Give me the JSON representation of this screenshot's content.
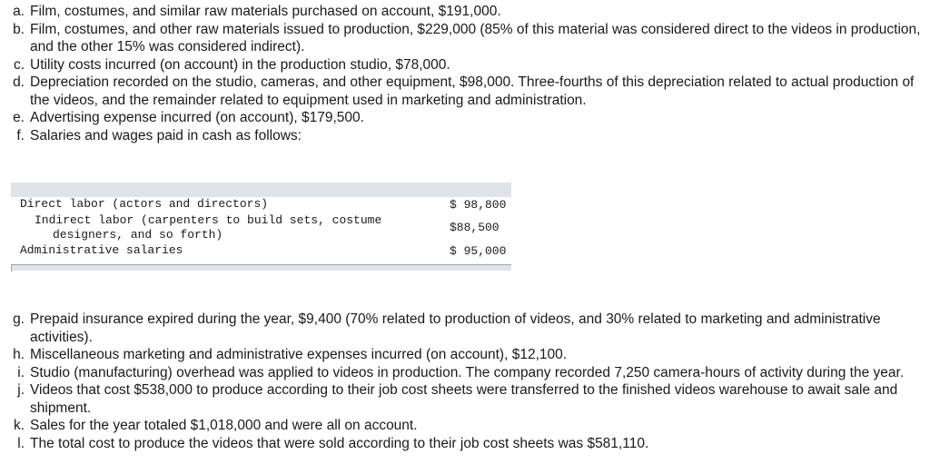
{
  "items_top": [
    {
      "marker": "a.",
      "text": "Film, costumes, and similar raw materials purchased on account, $191,000."
    },
    {
      "marker": "b.",
      "text": "Film, costumes, and other raw materials issued to production, $229,000 (85% of this material was considered direct to the videos in production, and the other 15% was considered indirect)."
    },
    {
      "marker": "c.",
      "text": "Utility costs incurred (on account) in the production studio, $78,000."
    },
    {
      "marker": "d.",
      "text": "Depreciation recorded on the studio, cameras, and other equipment, $98,000. Three-fourths of this depreciation related to actual production of the videos, and the remainder related to equipment used in marketing and administration."
    },
    {
      "marker": "e.",
      "text": "Advertising expense incurred (on account), $179,500."
    },
    {
      "marker": "f.",
      "text": "Salaries and wages paid in cash as follows:"
    }
  ],
  "salaries_table": {
    "rows": [
      {
        "line1": "Direct labor (actors and directors)",
        "line2": "",
        "amount": "$ 98,800"
      },
      {
        "line1": "Indirect labor (carpenters to build sets, costume",
        "line2": "designers, and so forth)",
        "amount": "$88,500"
      },
      {
        "line1": "Administrative salaries",
        "line2": "",
        "amount": "$ 95,000"
      }
    ]
  },
  "items_bottom": [
    {
      "marker": "g.",
      "text": "Prepaid insurance expired during the year, $9,400 (70% related to production of videos, and 30% related to marketing and administrative activities)."
    },
    {
      "marker": "h.",
      "text": "Miscellaneous marketing and administrative expenses incurred (on account), $12,100."
    },
    {
      "marker": "i.",
      "text": "Studio (manufacturing) overhead was applied to videos in production. The company recorded 7,250 camera-hours of activity during the year."
    },
    {
      "marker": "j.",
      "text": "Videos that cost $538,000 to produce according to their job cost sheets were transferred to the finished videos warehouse to await sale and shipment."
    },
    {
      "marker": "k.",
      "text": "Sales for the year totaled $1,018,000 and were all on account."
    },
    {
      "marker": "l.",
      "text": "The total cost to produce the videos that were sold according to their job cost sheets was $581,110."
    }
  ]
}
